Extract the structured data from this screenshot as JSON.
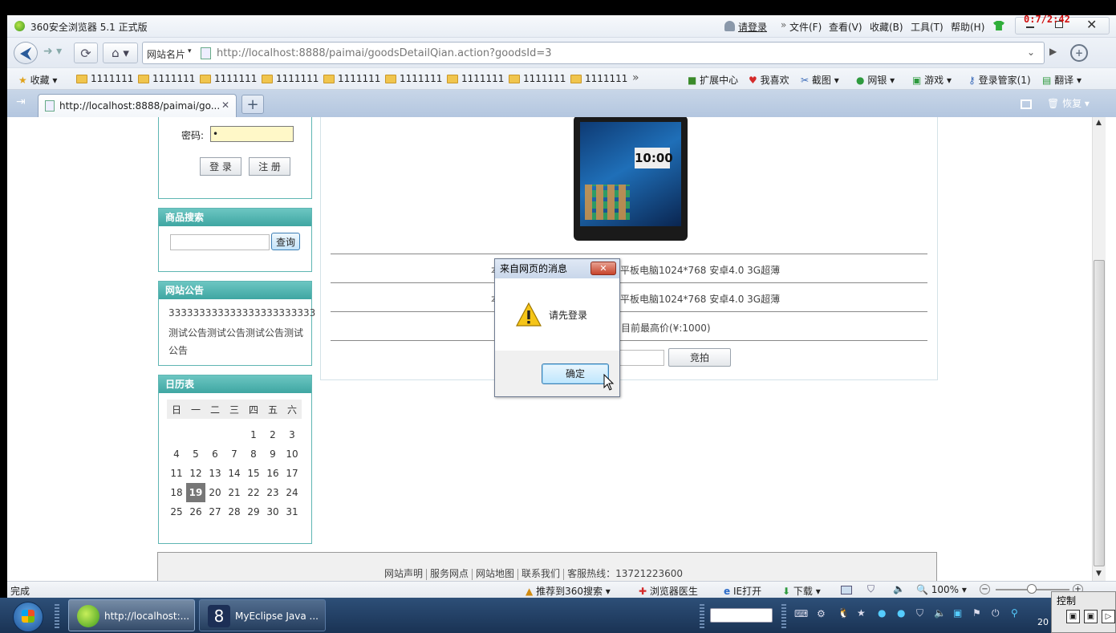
{
  "recording_timer": "0:7/2:42",
  "titlebar": {
    "app_title": "360安全浏览器 5.1 正式版",
    "login_link": "请登录",
    "menus": [
      "文件(F)",
      "查看(V)",
      "收藏(B)",
      "工具(T)",
      "帮助(H)"
    ]
  },
  "navbar": {
    "site_card": "网站名片",
    "url": "http://localhost:8888/paimai/goodsDetailQian.action?goodsId=3"
  },
  "favbar": {
    "favorites_label": "收藏",
    "folders": [
      "1111111",
      "1111111",
      "1111111",
      "1111111",
      "1111111",
      "1111111",
      "1111111",
      "1111111",
      "1111111"
    ],
    "more": "»",
    "tools": [
      "扩展中心",
      "我喜欢",
      "截图",
      "网银",
      "游戏",
      "登录管家(1)",
      "翻译"
    ]
  },
  "tabbar": {
    "tab_title": "http://localhost:8888/paimai/go...",
    "restore_label": "恢复"
  },
  "page": {
    "login": {
      "password_label": "密码:",
      "password_value": "•",
      "login_button": "登 录",
      "register_button": "注 册"
    },
    "search": {
      "heading": "商品搜索",
      "button": "查询"
    },
    "notice": {
      "heading": "网站公告",
      "text_line1": "333333333333333333333333",
      "text_line2": "测试公告测试公告测试公告测试",
      "text_line3": "公告"
    },
    "calendar": {
      "heading": "日历表",
      "weekdays": [
        "日",
        "一",
        "二",
        "三",
        "四",
        "五",
        "六"
      ],
      "rows": [
        [
          "",
          "",
          "",
          "",
          "1",
          "2",
          "3"
        ],
        [
          "4",
          "5",
          "6",
          "7",
          "8",
          "9",
          "10"
        ],
        [
          "11",
          "12",
          "13",
          "14",
          "15",
          "16",
          "17"
        ],
        [
          "18",
          "19",
          "20",
          "21",
          "22",
          "23",
          "24"
        ],
        [
          "25",
          "26",
          "27",
          "28",
          "29",
          "30",
          "31"
        ]
      ],
      "today": "19"
    },
    "product": {
      "tablet_time": "10:00",
      "row1_prefix": "本",
      "row1": "平板电脑1024*768 安卓4.0 3G超薄",
      "row2_prefix": "本",
      "row2": "平板电脑1024*768 安卓4.0 3G超薄",
      "row3": "目前最高价(¥:1000)",
      "bid_button": "竞拍"
    },
    "footer": {
      "links": [
        "网站声明",
        "服务网点",
        "网站地图",
        "联系我们"
      ],
      "hotline": "客服热线：13721223600"
    }
  },
  "dialog": {
    "title": "来自网页的消息",
    "message": "请先登录",
    "ok_button": "确定"
  },
  "statusbar": {
    "status": "完成",
    "recommend": "推荐到360搜索",
    "doctor": "浏览器医生",
    "ie_open": "IE打开",
    "download": "下载",
    "zoom": "100%"
  },
  "taskbar": {
    "items": [
      "http://localhost:...",
      "MyEclipse Java ..."
    ],
    "control_label": "控制",
    "clock_partial": "20"
  }
}
